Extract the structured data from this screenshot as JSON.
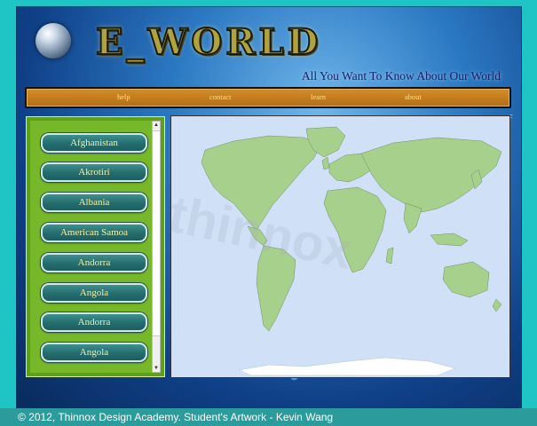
{
  "header": {
    "logo_text": "E_WORLD",
    "tagline": "All You Want To Know About Our World"
  },
  "nav": {
    "items": [
      "help",
      "contact",
      "learn",
      "about"
    ]
  },
  "sidebar": {
    "countries": [
      "Afghanistan",
      "Akrotiri",
      "Albania",
      "American Samoa",
      "Andorra",
      "Angola",
      "Andorra",
      "Angola"
    ]
  },
  "map": {
    "watermark": "thinnox",
    "land_color": "#a8d08d",
    "ocean_color": "#cfe0f7"
  },
  "footer": {
    "copyright": "© 2012, Thinnox Design Academy. Student's Artwork - Kevin Wang"
  },
  "colors": {
    "page_background": "#1fc4c4",
    "nav_background": "#c47f22",
    "sidebar_background": "#76b82a",
    "button_background": "#2e7b7b"
  }
}
